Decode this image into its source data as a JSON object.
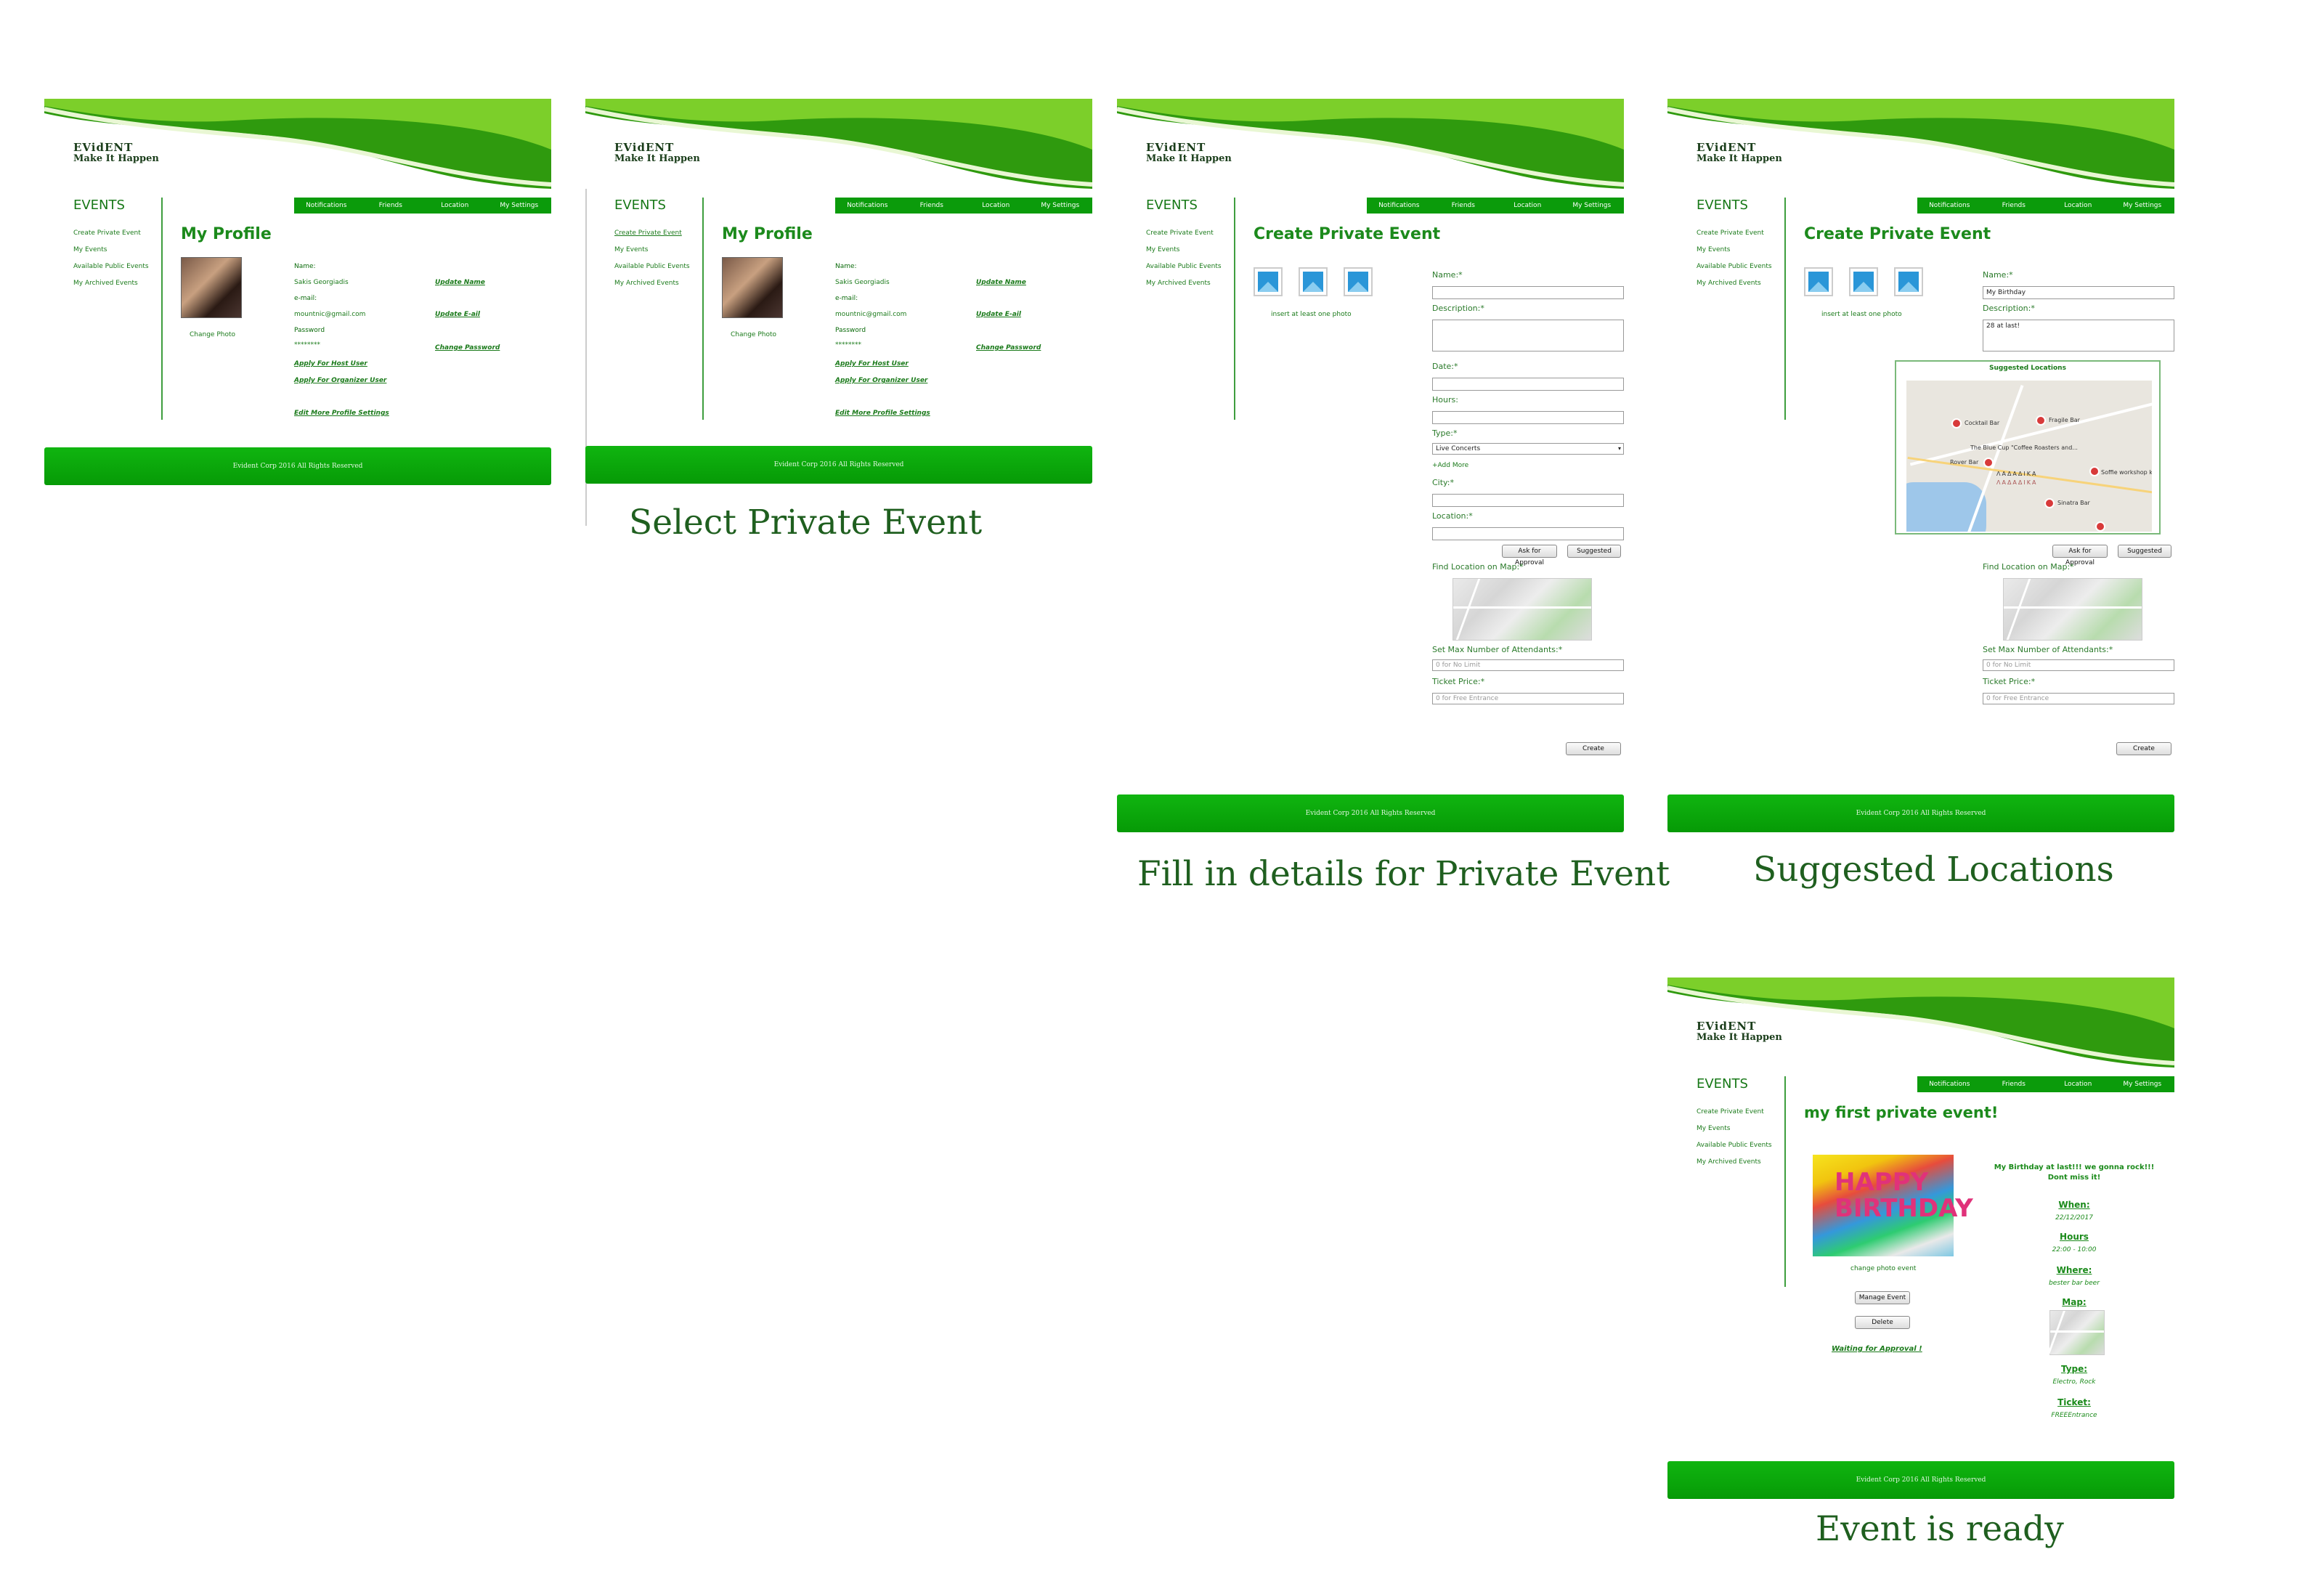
{
  "brand": {
    "name": "EVidENT",
    "tagline": "Make It Happen"
  },
  "nav": [
    "Notifications",
    "Friends",
    "Location",
    "My Settings"
  ],
  "sidebar": {
    "title": "EVENTS",
    "items": [
      "Create Private Event",
      "My Events",
      "Available Public Events",
      "My Archived Events"
    ]
  },
  "footer": "Evident Corp  2016 All Rights Reserved",
  "colors": {
    "primary": "#0b9b0b",
    "text": "#1f8a1f",
    "caption": "#1f5f1f"
  },
  "profile": {
    "title": "My Profile",
    "change_photo": "Change Photo",
    "name_label": "Name:",
    "name_value": "Sakis Georgiadis",
    "email_label": "e-mail:",
    "email_value": "mountnic@gmail.com",
    "password_label": "Password",
    "password_value": "********",
    "update_name": "Update Name",
    "update_email": "Update E-ail",
    "change_password": "Change Password",
    "apply_host": "Apply For Host User",
    "apply_organizer": "Apply For Organizer User",
    "edit_more": "Edit More Profile Settings"
  },
  "create": {
    "title": "Create Private Event",
    "photo_hint": "insert at least one photo",
    "name_label": "Name:*",
    "description_label": "Description:*",
    "date_label": "Date:*",
    "hours_label": "Hours:",
    "type_label": "Type:*",
    "type_value": "Live Concerts",
    "add_more": "+Add More",
    "city_label": "City:*",
    "location_label": "Location:*",
    "ask_approval": "Ask for Approval",
    "suggested": "Suggested",
    "find_map": "Find Location on Map:*",
    "max_label": "Set Max Number of Attendants:*",
    "max_placeholder": "0 for No Limit",
    "ticket_label": "Ticket Price:*",
    "ticket_placeholder": "0 for Free Entrance",
    "create_button": "Create"
  },
  "suggested": {
    "name_value": "My Birthday",
    "description_value": "28 at last!",
    "popup_title": "Suggested Locations",
    "map_labels": [
      "Cocktail Bar",
      "Fragile Bar",
      "The Blue Cup \"Coffee Roasters and...",
      "Rover Bar",
      "Soffie workshop kitchen and bar",
      "Sinatra Bar",
      "ΛΑΔΑΔΙΚΑ",
      "ΛΑΔΑΔΙΚΑ"
    ]
  },
  "event": {
    "title": "my first private event!",
    "photo_text": "HAPPY BIRTHDAY",
    "change_photo": "change photo event",
    "manage": "Manage Event",
    "delete": "Delete",
    "waiting": "Waiting for Approval !",
    "description": "My Birthday at last!!! we gonna rock!!!",
    "description2": "Dont miss it!",
    "when_label": "When:",
    "when_value": "22/12/2017",
    "hours_label": "Hours",
    "hours_value": "22:00 - 10:00",
    "where_label": "Where:",
    "where_value": "bester bar beer",
    "map_label": "Map:",
    "type_label": "Type:",
    "type_value": "Electro, Rock",
    "ticket_label": "Ticket:",
    "ticket_value": "FREEEntrance"
  },
  "captions": [
    "Select Private Event",
    "Fill in details for Private Event",
    "Suggested Locations",
    "Event is ready"
  ]
}
